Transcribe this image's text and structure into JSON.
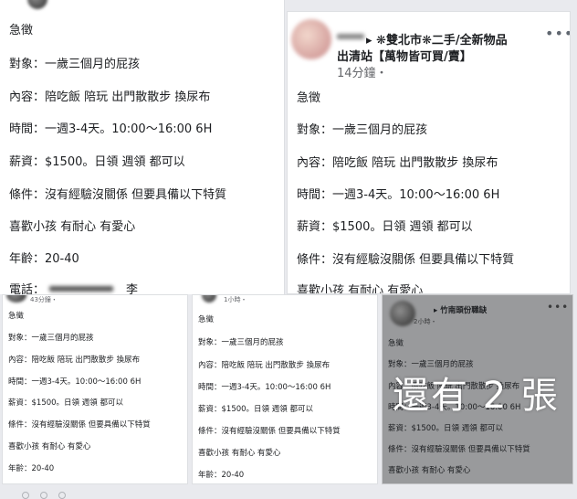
{
  "colors": {
    "page_bg": "#e9eaee",
    "panel_bg": "#ffffff",
    "dim_panel_bg": "#999a9c",
    "text": "#1c1e21",
    "meta": "#65676b"
  },
  "job_post": {
    "heading": "急徵",
    "target": "對象：一歲三個月的屁孩",
    "content": "內容：陪吃飯 陪玩 出門散散步 換尿布",
    "time": "時間：一週3-4天。10:00～16:00 6H",
    "pay": "薪資：$1500。日領 週領 都可以",
    "condition": "條件：沒有經驗沒關係 但要具備以下特質",
    "traits": "喜歡小孩 有耐心 有愛心",
    "age": "年齡：20-40"
  },
  "panel1": {
    "phone_label": "電話：",
    "phone_name": "李"
  },
  "panel2": {
    "group_line1": "▸ ❋雙北市❋二手/全新物品",
    "group_line2": "出清站【萬物皆可買/賣】",
    "time": "14分鐘・",
    "more_icon": "•••"
  },
  "panel3": {
    "time": "43分鐘・"
  },
  "panel4": {
    "time": "1小時・"
  },
  "panel5": {
    "group": "▸ 竹南頭份職缺",
    "time": "2小時・",
    "more_icon": "•••"
  },
  "overlay": {
    "text": "還有 2 張"
  }
}
